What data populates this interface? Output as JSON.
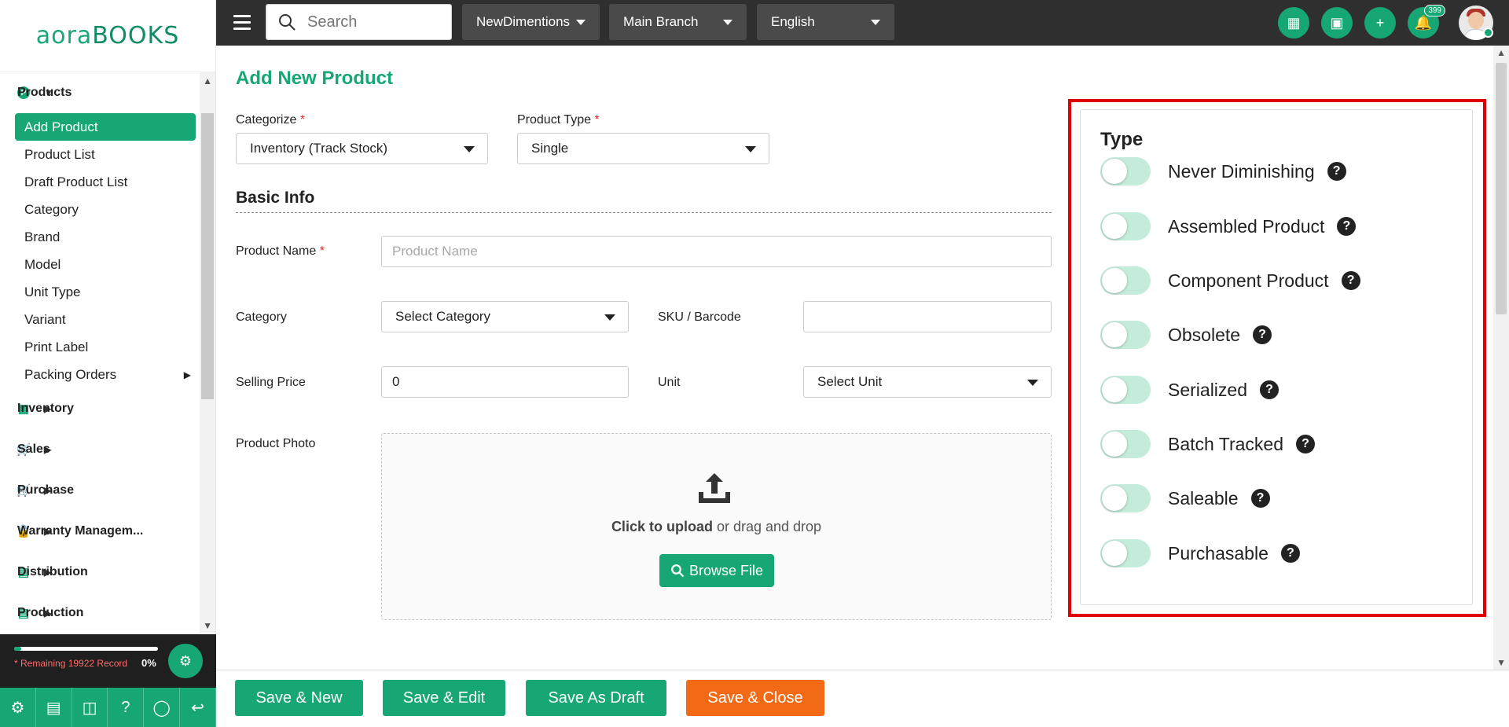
{
  "brand": {
    "logo_left": "aora",
    "logo_right": "BOOKS"
  },
  "topbar": {
    "search_placeholder": "Search",
    "company": "NewDimentions",
    "branch": "Main Branch",
    "language": "English",
    "notification_count": "399"
  },
  "sidebar": {
    "products_label": "Products",
    "product_items": [
      {
        "label": "Add Product"
      },
      {
        "label": "Product List"
      },
      {
        "label": "Draft Product List"
      },
      {
        "label": "Category"
      },
      {
        "label": "Brand"
      },
      {
        "label": "Model"
      },
      {
        "label": "Unit Type"
      },
      {
        "label": "Variant"
      },
      {
        "label": "Print Label"
      },
      {
        "label": "Packing Orders"
      }
    ],
    "groups": [
      {
        "label": "Inventory",
        "icon": "bank-icon"
      },
      {
        "label": "Sales",
        "icon": "cart-icon"
      },
      {
        "label": "Purchase",
        "icon": "cart-icon"
      },
      {
        "label": "Warranty Managem...",
        "icon": "lock-icon"
      },
      {
        "label": "Distribution",
        "icon": "file-icon"
      },
      {
        "label": "Production",
        "icon": "file-icon"
      }
    ],
    "footer": {
      "remaining": "* Remaining 19922 Record",
      "percent": "0%",
      "progress": 0.05
    }
  },
  "form": {
    "title": "Add New Product",
    "categorize_label": "Categorize",
    "categorize_value": "Inventory (Track Stock)",
    "product_type_label": "Product Type",
    "product_type_value": "Single",
    "basic_info": "Basic Info",
    "product_name_label": "Product Name",
    "product_name_placeholder": "Product Name",
    "category_label": "Category",
    "category_value": "Select Category",
    "sku_label": "SKU / Barcode",
    "selling_price_label": "Selling Price",
    "selling_price_value": "0",
    "unit_label": "Unit",
    "unit_value": "Select Unit",
    "photo_label": "Product Photo",
    "upload_strong": "Click to upload",
    "upload_rest": " or drag and drop",
    "browse": "Browse File",
    "required_mark": "*"
  },
  "type_panel": {
    "title": "Type",
    "toggles": [
      {
        "label": "Never Diminishing",
        "on": false
      },
      {
        "label": "Assembled Product",
        "on": false
      },
      {
        "label": "Component Product",
        "on": false
      },
      {
        "label": "Obsolete",
        "on": false
      },
      {
        "label": "Serialized",
        "on": false
      },
      {
        "label": "Batch Tracked",
        "on": false
      },
      {
        "label": "Saleable",
        "on": false
      },
      {
        "label": "Purchasable",
        "on": false
      }
    ],
    "help_glyph": "?"
  },
  "actions": {
    "save_new": "Save & New",
    "save_edit": "Save & Edit",
    "save_draft": "Save As Draft",
    "save_close": "Save & Close"
  },
  "colors": {
    "accent": "#17a774",
    "danger": "#f26a15",
    "highlight": "#e00000"
  }
}
